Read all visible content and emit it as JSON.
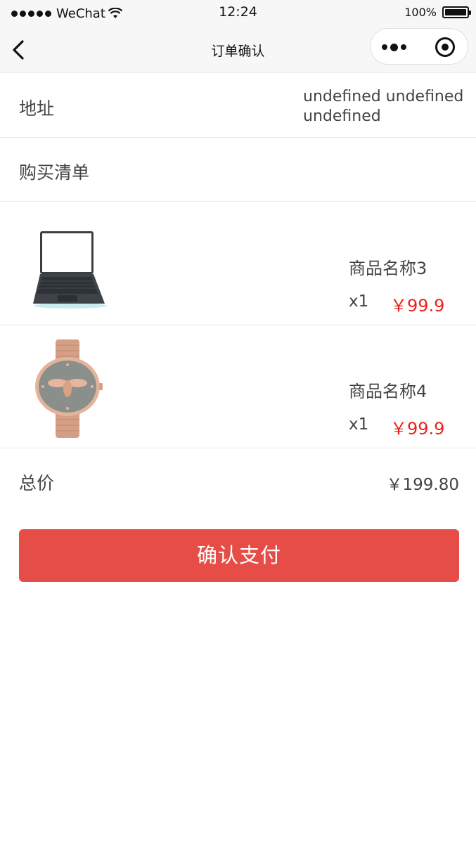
{
  "status_bar": {
    "carrier": "WeChat",
    "time": "12:24",
    "battery": "100%"
  },
  "nav": {
    "title": "订单确认"
  },
  "address": {
    "label": "地址",
    "value": "undefined undefined undefined"
  },
  "purchase_list": {
    "label": "购买清单"
  },
  "items": [
    {
      "name": "商品名称3",
      "qty": "x1",
      "price": "￥99.9",
      "image": "laptop"
    },
    {
      "name": "商品名称4",
      "qty": "x1",
      "price": "￥99.9",
      "image": "watch"
    }
  ],
  "total": {
    "label": "总价",
    "value": "￥199.80"
  },
  "pay_button": {
    "label": "确认支付"
  },
  "colors": {
    "accent": "#e54d46",
    "price": "#e8231b",
    "nav_bg": "#f7f7f7"
  }
}
